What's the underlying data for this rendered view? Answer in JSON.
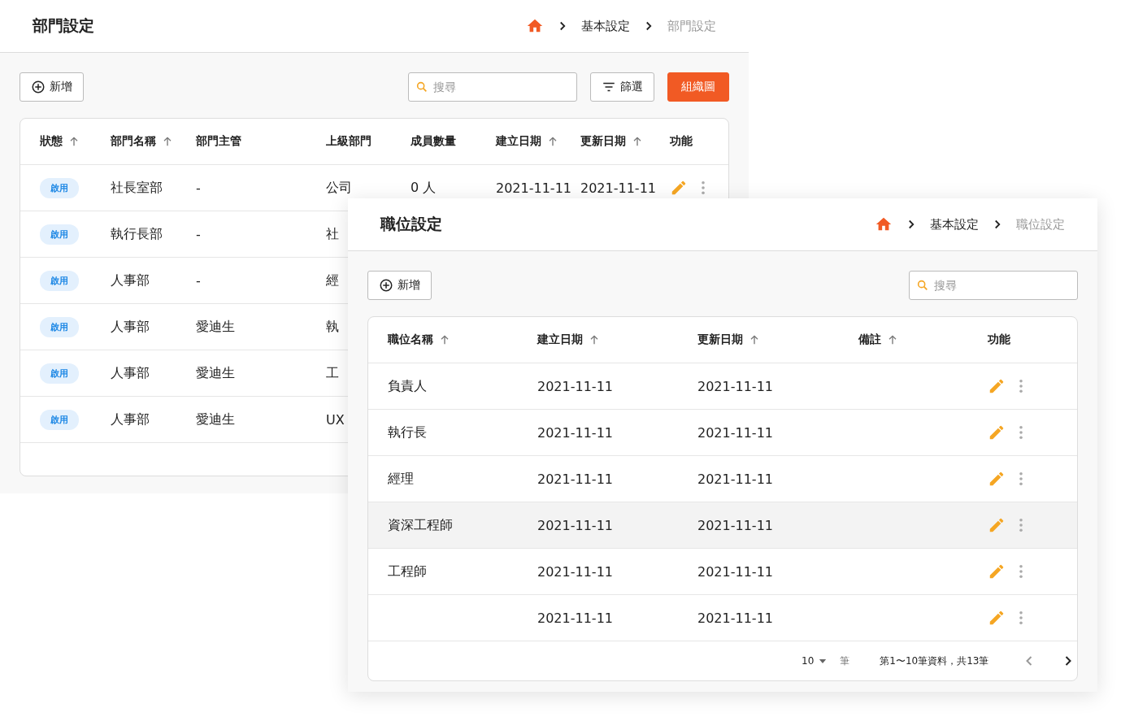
{
  "department_panel": {
    "title": "部門設定",
    "breadcrumb": [
      {
        "label": "基本設定",
        "current": false
      },
      {
        "label": "部門設定",
        "current": true
      }
    ],
    "add_button": "新增",
    "search": {
      "placeholder": "搜尋"
    },
    "filter_button": "篩選",
    "org_chart_button": "組織圖",
    "table": {
      "columns": [
        {
          "label": "狀態",
          "sortable": true
        },
        {
          "label": "部門名稱",
          "sortable": true
        },
        {
          "label": "部門主管",
          "sortable": false
        },
        {
          "label": "上級部門",
          "sortable": false
        },
        {
          "label": "成員數量",
          "sortable": false
        },
        {
          "label": "建立日期",
          "sortable": true
        },
        {
          "label": "更新日期",
          "sortable": true
        },
        {
          "label": "功能",
          "sortable": false
        }
      ],
      "rows": [
        {
          "status": "啟用",
          "name": "社長室部",
          "manager": "-",
          "parent": "公司",
          "members": "0 人",
          "created": "2021-11-11",
          "updated": "2021-11-11",
          "actions": true
        },
        {
          "status": "啟用",
          "name": "執行長部",
          "manager": "-",
          "parent": "社"
        },
        {
          "status": "啟用",
          "name": "人事部",
          "manager": "-",
          "parent": "經"
        },
        {
          "status": "啟用",
          "name": "人事部",
          "manager": "愛迪生",
          "parent": "執"
        },
        {
          "status": "啟用",
          "name": "人事部",
          "manager": "愛迪生",
          "parent": "工"
        },
        {
          "status": "啟用",
          "name": "人事部",
          "manager": "愛迪生",
          "parent": "UX"
        }
      ]
    }
  },
  "position_panel": {
    "title": "職位設定",
    "breadcrumb": [
      {
        "label": "基本設定",
        "current": false
      },
      {
        "label": "職位設定",
        "current": true
      }
    ],
    "add_button": "新增",
    "search": {
      "placeholder": "搜尋"
    },
    "table": {
      "columns": [
        {
          "label": "職位名稱",
          "sortable": true
        },
        {
          "label": "建立日期",
          "sortable": true
        },
        {
          "label": "更新日期",
          "sortable": true
        },
        {
          "label": "備註",
          "sortable": true
        },
        {
          "label": "功能",
          "sortable": false
        }
      ],
      "rows": [
        {
          "name": "負責人",
          "created": "2021-11-11",
          "updated": "2021-11-11",
          "selected": false
        },
        {
          "name": "執行長",
          "created": "2021-11-11",
          "updated": "2021-11-11",
          "selected": false
        },
        {
          "name": "經理",
          "created": "2021-11-11",
          "updated": "2021-11-11",
          "selected": false
        },
        {
          "name": "資深工程師",
          "created": "2021-11-11",
          "updated": "2021-11-11",
          "selected": true
        },
        {
          "name": "工程師",
          "created": "2021-11-11",
          "updated": "2021-11-11",
          "selected": false
        },
        {
          "created": "2021-11-11",
          "updated": "2021-11-11",
          "selected": false
        }
      ]
    },
    "pagination": {
      "page_size": "10",
      "unit": "筆",
      "range": "第1〜10筆資料，共13筆",
      "previous_disabled": true,
      "next_disabled": false
    }
  }
}
